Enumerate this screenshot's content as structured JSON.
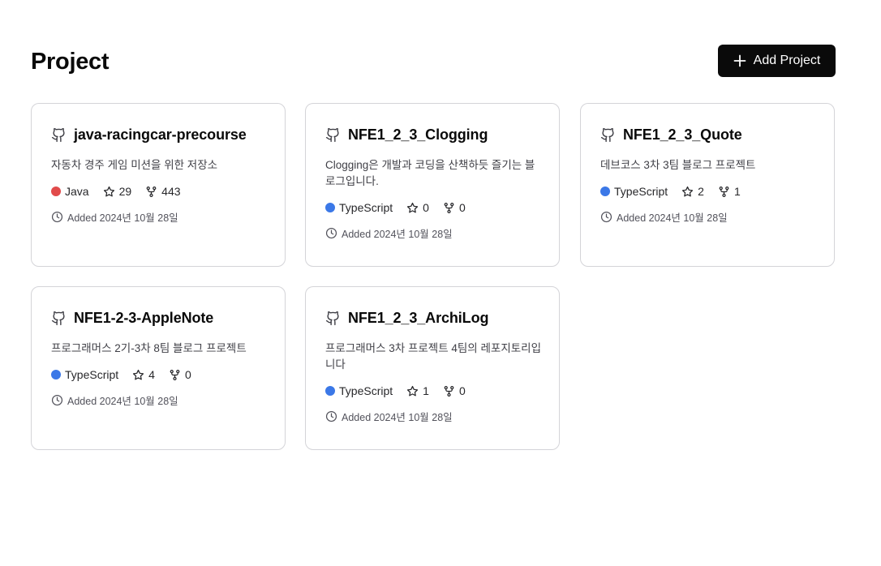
{
  "page": {
    "title": "Project",
    "add_button_label": "Add Project"
  },
  "projects": [
    {
      "name": "java-racingcar-precourse",
      "description": "자동차 경주 게임 미션을 위한 저장소",
      "language": "Java",
      "language_color": "#e14b4b",
      "stars": "29",
      "forks": "443",
      "added": "Added 2024년 10월 28일"
    },
    {
      "name": "NFE1_2_3_Clogging",
      "description": "Clogging은 개발과 코딩을 산책하듯 즐기는 블로그입니다.",
      "language": "TypeScript",
      "language_color": "#3b78e7",
      "stars": "0",
      "forks": "0",
      "added": "Added 2024년 10월 28일"
    },
    {
      "name": "NFE1_2_3_Quote",
      "description": "데브코스 3차 3팀 블로그 프로젝트",
      "language": "TypeScript",
      "language_color": "#3b78e7",
      "stars": "2",
      "forks": "1",
      "added": "Added 2024년 10월 28일"
    },
    {
      "name": "NFE1-2-3-AppleNote",
      "description": "프로그래머스 2기-3차 8팀 블로그 프로젝트",
      "language": "TypeScript",
      "language_color": "#3b78e7",
      "stars": "4",
      "forks": "0",
      "added": "Added 2024년 10월 28일"
    },
    {
      "name": "NFE1_2_3_ArchiLog",
      "description": "프로그래머스 3차 프로젝트 4팀의 레포지토리입니다",
      "language": "TypeScript",
      "language_color": "#3b78e7",
      "stars": "1",
      "forks": "0",
      "added": "Added 2024년 10월 28일"
    }
  ]
}
